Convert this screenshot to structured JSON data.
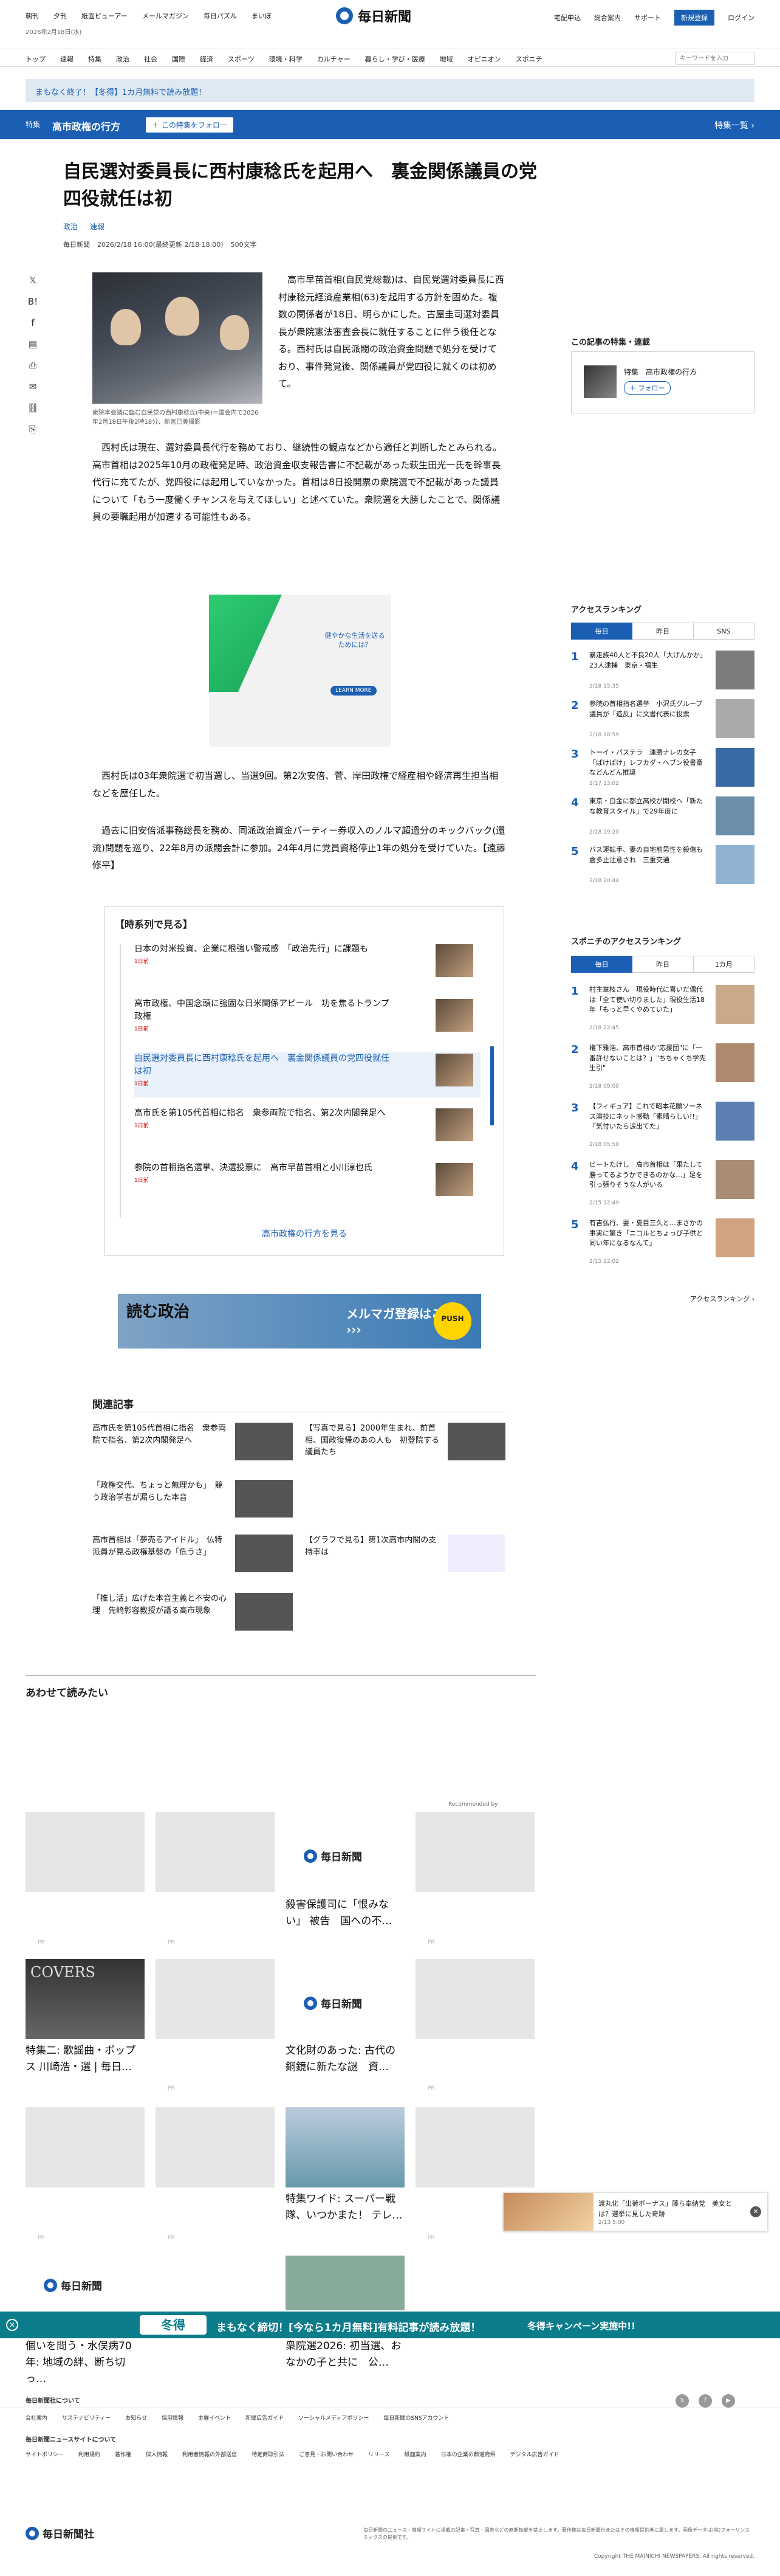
{
  "header": {
    "top_links": [
      "朝刊",
      "夕刊",
      "紙面ビューアー",
      "メールマガジン",
      "毎日パズル",
      "まいぼ"
    ],
    "date": "2026年2月18日(水)",
    "logo": "毎日新聞",
    "right_links": [
      "宅配申込",
      "総合案内",
      "サポート"
    ],
    "register_label": "新規登録",
    "login_label": "ログイン"
  },
  "nav": {
    "items": [
      "トップ",
      "速報",
      "特集",
      "政治",
      "社会",
      "国際",
      "経済",
      "スポーツ",
      "環境・科学",
      "カルチャー",
      "暮らし・学び・医療",
      "地域",
      "オピニオン",
      "スポニチ"
    ],
    "search_placeholder": "キーワードを入力"
  },
  "promo": {
    "text": "まもなく終了！【冬得】1カ月無料で読み放題！"
  },
  "feature_band": {
    "tag": "特集",
    "title": "高市政権の行方",
    "follow_label": "＋ この特集をフォロー",
    "more_label": "特集一覧 ›"
  },
  "article": {
    "headline": "自民選対委員長に西村康稔氏を起用へ　裏金関係議員の党四役就任は初",
    "categories": [
      "政治",
      "速報"
    ],
    "byline": "毎日新聞",
    "published": "2026/2/18 16:00(最終更新 2/18 18:00)",
    "chars": "500文字",
    "share_icons": [
      "x-icon",
      "hatena-icon",
      "facebook-icon",
      "note-icon",
      "bookmark-icon",
      "mail-icon",
      "link-icon",
      "print-icon"
    ],
    "photo_caption": "衆院本会議に臨む自民党の西村康稔氏(中央)＝国会内で2026年2月18日午後2時18分、新宮巳美撮影",
    "p1": "　高市早苗首相(自民党総裁)は、自民党選対委員長に西村康稔元経済産業相(63)を起用する方針を固めた。複数の関係者が18日、明らかにした。古屋圭司選対委員長が衆院憲法審査会長に就任することに伴う後任となる。西村氏は自民派閥の政治資金問題で処分を受けており、事件発覚後、関係議員が党四役に就くのは初めて。",
    "p2": "　西村氏は現在、選対委員長代行を務めており、継続性の観点などから適任と判断したとみられる。高市首相は2025年10月の政権発足時、政治資金収支報告書に不記載があった萩生田光一氏を幹事長代行に充てたが、党四役には起用していなかった。首相は8日投開票の衆院選で不記載があった議員について「もう一度働くチャンスを与えてほしい」と述べていた。衆院選を大勝したことで、関係議員の要職起用が加速する可能性もある。",
    "p3": "　西村氏は03年衆院選で初当選し、当選9回。第2次安倍、菅、岸田政権で経産相や経済再生担当相などを歴任した。",
    "p4": "　過去に旧安倍派事務総長を務め、同派政治資金パーティー券収入のノルマ超過分のキックバック(還流)問題を巡り、22年8月の派閥会計に参加。24年4月に党員資格停止1年の処分を受けていた。【遠藤修平】"
  },
  "ad_left": {
    "text": "健やかな生活を送るためには？",
    "button": "LEARN MORE"
  },
  "series": {
    "title": "【時系列で見る】",
    "items": [
      {
        "title": "日本の対米投資、企業に根強い警戒感　「政治先行」に課題も",
        "meta": "1日前"
      },
      {
        "title": "高市政権、中国念頭に強固な日米関係アピール　功を焦るトランプ政権",
        "meta": "1日前"
      },
      {
        "title": "自民選対委員長に西村康稔氏を起用へ　裏金関係議員の党四役就任は初",
        "meta": "1日前"
      },
      {
        "title": "高市氏を第105代首相に指名　衆参両院で指名、第2次内閣発足へ",
        "meta": "1日前"
      },
      {
        "title": "参院の首相指名選挙、決選投票に　高市早苗首相と小川淳也氏",
        "meta": "1日前"
      }
    ],
    "more_label": "高市政権の行方を見る"
  },
  "mag_banner": {
    "left": "読む政治",
    "mid": "メルマガ登録はこちら ›››",
    "badge": "PUSH"
  },
  "related": {
    "title": "関連記事",
    "items": [
      "高市氏を第105代首相に指名　衆参両院で指名、第2次内閣発足へ",
      "【写真で見る】2000年生まれ、前首相、国政復帰のあの人も　初登院する議員たち",
      "「政権交代、ちょっと無理かも」　競う政治学者が漏らした本音",
      "高市首相は「夢売るアイドル」　仏特派員が見る政権基盤の「危うさ」",
      "【グラフで見る】第1次高市内閣の支持率は",
      "「推し活」広げた本音主義と不安の心理　先崎彰容教授が語る高市現象"
    ]
  },
  "also_read": {
    "title": "あわせて読みたい",
    "recommended_by": "Recommended by",
    "pr": "PR",
    "titles": [
      "殺害保護司に「恨みない」 被告　国への不…",
      "特集二: 歌謡曲・ポップス 川崎浩・選 | 毎日…",
      "文化財のあった: 古代の銅鏡に新たな謎　資…",
      "特集ワイド: スーパー戦隊、いつかまた！ テレ…",
      "個いを問う・水俣病70年: 地域の絆、断ち切っ…",
      "衆院選2026: 初当選、おなかの子と共に　公…"
    ],
    "cover_label": "COVERS"
  },
  "campaign": {
    "badge": "冬得",
    "main": "まもなく締切！[今なら1カ月無料]有料記事が読み放題！",
    "sub": "冬得キャンペーン実施中!!"
  },
  "toast": {
    "title": "渡丸化「出荷ボーナス」藤ら奉納党　美女とは？選挙に見した奇跡",
    "time": "2/13 5:00"
  },
  "sidebar": {
    "feature_title": "この記事の特集・連載",
    "feature_label": "特集　高市政権の行方",
    "feature_follow": "＋ フォロー",
    "ranking_title": "アクセスランキング",
    "ranking_tabs": [
      "毎日",
      "昨日",
      "SNS"
    ],
    "ranking": [
      {
        "n": "1",
        "t": "暴走族40人と不良20人「大げんかか」23人逮捕　東京・福生",
        "d": "2/18 15:35"
      },
      {
        "n": "2",
        "t": "参院の首相指名選挙　小沢氏グループ議員が「造反」に文書代表に投票",
        "d": "2/18 18:59"
      },
      {
        "n": "3",
        "t": "トーイ・パステラ　連勝ナレの女子「ばけばけ」レフカダ・ヘブン役書斎などんどん推奨",
        "d": "2/17 13:02"
      },
      {
        "n": "4",
        "t": "東京・白金に都立高校が開校へ「新たな教育スタイル」で29年度に",
        "d": "2/18 19:20"
      },
      {
        "n": "5",
        "t": "バス運転手、妻の自宅前男性を殺傷も　倉多止注意され　三重交通",
        "d": "2/18 20:44"
      }
    ],
    "sponichi_title": "スポニチのアクセスランキング",
    "sponichi_tabs": [
      "毎日",
      "昨日",
      "1カ月"
    ],
    "sponichi": [
      {
        "n": "1",
        "t": "村主章枝さん　現役時代に喜いだ偶代は「全て使い切りました」現役生活18年「もっと早くやめていた」",
        "d": "2/18 22:45"
      },
      {
        "n": "2",
        "t": "権下雅浩、高市首相の\"応援団\"に「一番許せないことは？」\"ちちゃくち学先生引\"",
        "d": "2/18 09:00"
      },
      {
        "n": "3",
        "t": "【フィギュア】これで昭本花願ソーネス演技にネット感動「素晴らしい!!」「気付いたら涙出てた」",
        "d": "2/18 05:50"
      },
      {
        "n": "4",
        "t": "ビートたけし　高市首相は「果たして勝ってるようかできるのかな…」足を引っ張りそうな人がいる",
        "d": "2/15 12:49"
      },
      {
        "n": "5",
        "t": "有吉弘行、妻・夏目三久と…まさかの事実に驚き「ニコルとちょっぴ子供と同い年になるなんて」",
        "d": "2/15 22:02"
      }
    ],
    "ranking_more": "アクセスランキング ›"
  },
  "footer": {
    "about_title": "毎日新聞社について",
    "about_links": [
      "会社案内",
      "サステナビリティー",
      "お知らせ",
      "採用情報",
      "主催イベント",
      "新聞広告ガイド",
      "ソーシャルメディアポリシー",
      "毎日新聞のSNSアカウント"
    ],
    "site_title": "毎日新聞ニュースサイトについて",
    "site_links": [
      "サイトポリシー",
      "利用規約",
      "著作権",
      "個人情報",
      "利用者情報の外部送信",
      "特定商取引法",
      "ご意見・お問い合わせ",
      "リリース",
      "紙面案内",
      "日本の企業の都道府県",
      "デジタル広告ガイド"
    ],
    "company": "毎日新聞社",
    "note": "毎日新聞のニュース・情報サイトに掲載の記事・写真・図表などの無断転載を禁止します。著作権は毎日新聞社またはその情報提供者に属します。画像データは(株)フォーリンスミックスの提供です。",
    "copyright": "Copyright THE MAINICHI NEWSPAPERS. All rights reserved."
  },
  "colors": {
    "brand": "#1a5fb4",
    "campaign": "#0b7c8a"
  }
}
